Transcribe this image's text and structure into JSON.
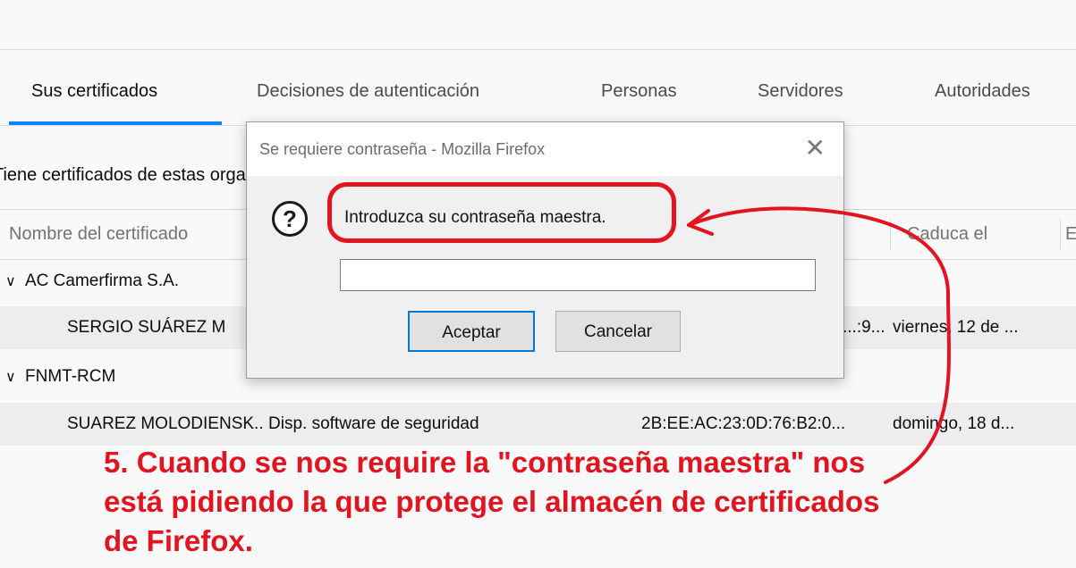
{
  "tabs": [
    {
      "label": "Sus certificados",
      "selected": true
    },
    {
      "label": "Decisiones de autenticación",
      "selected": false
    },
    {
      "label": "Personas",
      "selected": false
    },
    {
      "label": "Servidores",
      "selected": false
    },
    {
      "label": "Autoridades",
      "selected": false
    }
  ],
  "intro_text": "Tiene certificados de estas organizaciones que le identifican:",
  "columns": [
    "Nombre del certificado",
    "Caduca el",
    "E"
  ],
  "groups": [
    {
      "name": "AC Camerfirma S.A.",
      "rows": [
        {
          "name": "SERGIO SUÁREZ M",
          "device": "",
          "serial": "...:9...",
          "expires": "viernes, 12 de ..."
        }
      ]
    },
    {
      "name": "FNMT-RCM",
      "rows": [
        {
          "name": "SUAREZ MOLODIENSK...",
          "device": "Disp. software de seguridad",
          "serial": "2B:EE:AC:23:0D:76:B2:0...",
          "expires": "domingo, 18 d..."
        }
      ]
    }
  ],
  "dialog": {
    "title": "Se requiere contraseña - Mozilla Firefox",
    "message": "Introduzca su contraseña maestra.",
    "password_value": "",
    "ok_label": "Aceptar",
    "cancel_label": "Cancelar",
    "close_glyph": "✕",
    "icon": "question-icon"
  },
  "annotation": {
    "color": "#e1141f",
    "lines": [
      "5. Cuando se nos require la \"contraseña maestra\" nos",
      "está pidiendo la que protege el almacén de certificados",
      "de Firefox."
    ]
  },
  "colors": {
    "accent": "#0a84ff",
    "row_highlight": "#ededf0",
    "annotation_red": "#e1141f"
  }
}
